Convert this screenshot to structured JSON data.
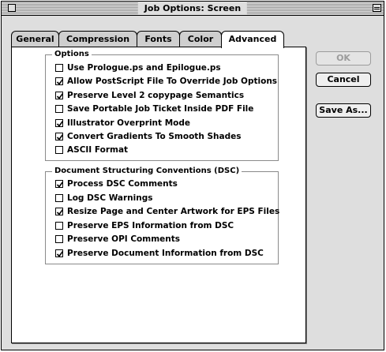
{
  "window": {
    "title": "Job Options: Screen"
  },
  "tabs": [
    {
      "label": "General",
      "active": false
    },
    {
      "label": "Compression",
      "active": false
    },
    {
      "label": "Fonts",
      "active": false
    },
    {
      "label": "Color",
      "active": false
    },
    {
      "label": "Advanced",
      "active": true
    }
  ],
  "options_group": {
    "title": "Options",
    "items": [
      {
        "label": "Use Prologue.ps and Epilogue.ps",
        "checked": false
      },
      {
        "label": "Allow PostScript File To Override Job Options",
        "checked": true
      },
      {
        "label": "Preserve Level 2 copypage Semantics",
        "checked": true
      },
      {
        "label": "Save Portable Job Ticket Inside PDF File",
        "checked": false
      },
      {
        "label": "Illustrator Overprint Mode",
        "checked": true
      },
      {
        "label": "Convert Gradients To Smooth Shades",
        "checked": true
      },
      {
        "label": "ASCII Format",
        "checked": false
      }
    ]
  },
  "dsc_group": {
    "title": "Document Structuring Conventions (DSC)",
    "items": [
      {
        "label": "Process DSC Comments",
        "checked": true
      },
      {
        "label": "Log DSC Warnings",
        "checked": false
      },
      {
        "label": "Resize Page and Center Artwork for EPS Files",
        "checked": true
      },
      {
        "label": "Preserve EPS Information from DSC",
        "checked": false
      },
      {
        "label": "Preserve OPI Comments",
        "checked": false
      },
      {
        "label": "Preserve Document Information from DSC",
        "checked": true
      }
    ]
  },
  "buttons": {
    "ok": {
      "label": "OK",
      "enabled": false
    },
    "cancel": {
      "label": "Cancel",
      "enabled": true
    },
    "save_as": {
      "label": "Save As...",
      "enabled": true
    }
  }
}
